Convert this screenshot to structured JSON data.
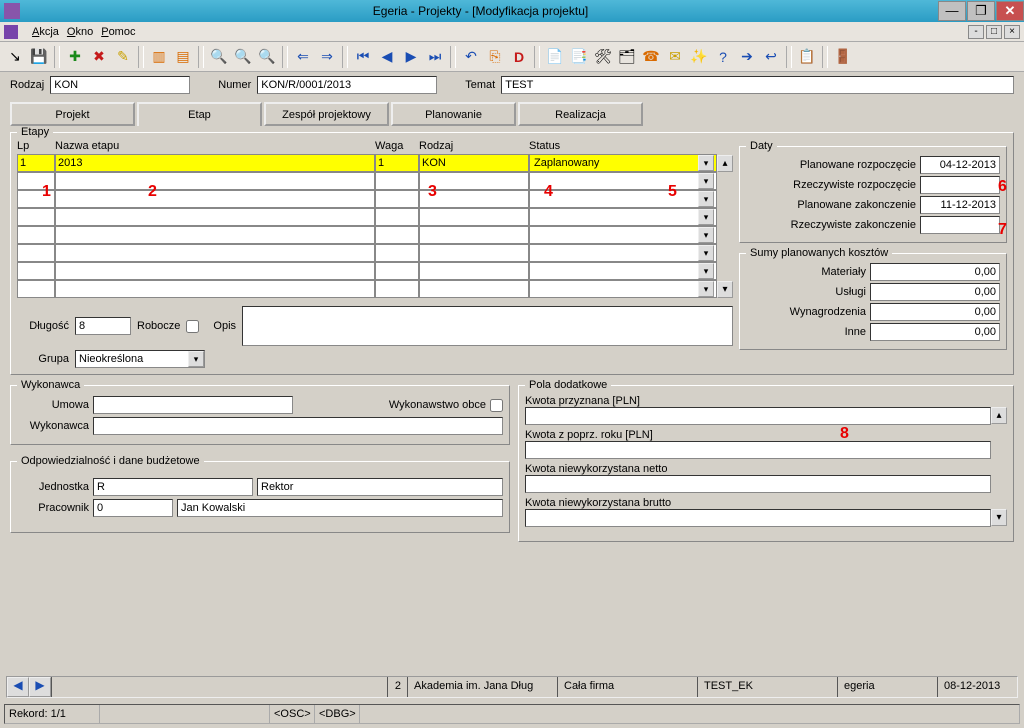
{
  "window": {
    "title": "Egeria - Projekty - [Modyfikacja projektu]"
  },
  "menu": {
    "akcja": "Akcja",
    "okno": "Okno",
    "pomoc": "Pomoc"
  },
  "summary": {
    "rodzaj_label": "Rodzaj",
    "rodzaj_value": "KON",
    "numer_label": "Numer",
    "numer_value": "KON/R/0001/2013",
    "temat_label": "Temat",
    "temat_value": "TEST"
  },
  "tabs": {
    "projekt": "Projekt",
    "etap": "Etap",
    "zespol": "Zespół projektowy",
    "planowanie": "Planowanie",
    "realizacja": "Realizacja"
  },
  "etapy": {
    "legend": "Etapy",
    "headers": {
      "lp": "Lp",
      "nazwa": "Nazwa etapu",
      "waga": "Waga",
      "rodzaj": "Rodzaj",
      "status": "Status"
    },
    "row": {
      "lp": "1",
      "nazwa": "2013",
      "waga": "1",
      "rodzaj": "KON",
      "status": "Zaplanowany"
    },
    "dlugosc_label": "Długość",
    "dlugosc_value": "8",
    "robocze_label": "Robocze",
    "opis_label": "Opis",
    "grupa_label": "Grupa",
    "grupa_value": "Nieokreślona"
  },
  "daty": {
    "legend": "Daty",
    "plan_rozp_label": "Planowane rozpoczęcie",
    "plan_rozp_value": "04-12-2013",
    "rzecz_rozp_label": "Rzeczywiste rozpoczęcie",
    "rzecz_rozp_value": "",
    "plan_zak_label": "Planowane zakonczenie",
    "plan_zak_value": "11-12-2013",
    "rzecz_zak_label": "Rzeczywiste zakonczenie",
    "rzecz_zak_value": ""
  },
  "koszty": {
    "legend": "Sumy planowanych kosztów",
    "materialy_label": "Materiały",
    "materialy_value": "0,00",
    "uslugi_label": "Usługi",
    "uslugi_value": "0,00",
    "wynagrodzenia_label": "Wynagrodzenia",
    "wynagrodzenia_value": "0,00",
    "inne_label": "Inne",
    "inne_value": "0,00"
  },
  "wykonawca": {
    "legend": "Wykonawca",
    "umowa_label": "Umowa",
    "umowa_value": "",
    "obce_label": "Wykonawstwo obce",
    "wykonawca_label": "Wykonawca",
    "wykonawca_value": ""
  },
  "odpow": {
    "legend": "Odpowiedzialność i dane budżetowe",
    "jednostka_label": "Jednostka",
    "jednostka_code": "R",
    "jednostka_name": "Rektor",
    "pracownik_label": "Pracownik",
    "pracownik_code": "0",
    "pracownik_name": "Jan Kowalski"
  },
  "pola": {
    "legend": "Pola dodatkowe",
    "kwota_przyznana_label": "Kwota przyznana [PLN]",
    "kwota_poprz_label": "Kwota z poprz. roku [PLN]",
    "kwota_netto_label": "Kwota niewykorzystana netto",
    "kwota_brutto_label": "Kwota niewykorzystana brutto"
  },
  "navbar": {
    "num": "2",
    "org": "Akademia im. Jana Dług",
    "firma": "Cała firma",
    "user": "TEST_EK",
    "app": "egeria",
    "date": "08-12-2013"
  },
  "status": {
    "rekord": "Rekord: 1/1",
    "osc": "<OSC>",
    "dbg": "<DBG>"
  },
  "annot": {
    "a1": "1",
    "a2": "2",
    "a3": "3",
    "a4": "4",
    "a5": "5",
    "a6": "6",
    "a7": "7",
    "a8": "8"
  }
}
